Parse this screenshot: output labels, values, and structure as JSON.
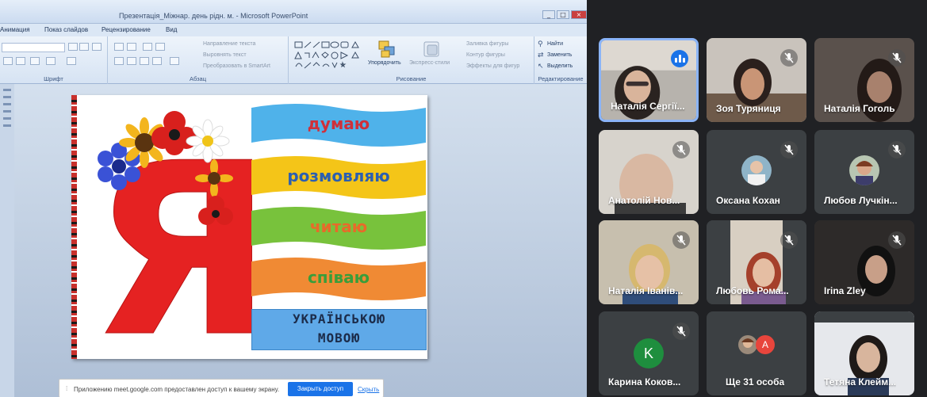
{
  "window": {
    "title": "Презентація_Міжнар. день рідн. м. - Microsoft PowerPoint",
    "controls": [
      "_",
      "□",
      "×"
    ]
  },
  "menu": {
    "items": [
      "Анимация",
      "Показ слайдов",
      "Рецензирование",
      "Вид"
    ]
  },
  "ribbon": {
    "groups": {
      "font": "Шрифт",
      "paragraph": "Абзац",
      "drawing": "Рисование",
      "editing": "Редактирование"
    },
    "paragraph_items": [
      "Направление текста",
      "Выровнять текст",
      "Преобразовать в SmartArt"
    ],
    "drawing_items": {
      "arrange": "Упорядочить",
      "quick_styles": "Экспресс-стили",
      "fill": "Заливка фигуры",
      "outline": "Контур фигуры",
      "effects": "Эффекты для фигур"
    },
    "editing_items": [
      "Найти",
      "Заменить",
      "Выделить"
    ]
  },
  "slide": {
    "big_letter": "Я",
    "words": [
      "думаю",
      "розмовляю",
      "читаю",
      "співаю"
    ],
    "word_colors": [
      "#d0303a",
      "#2c5fb0",
      "#e86a2a",
      "#3a9d3a"
    ],
    "band_colors": [
      "#4fb2ea",
      "#f4c518",
      "#78c23c",
      "#f08a34"
    ],
    "bottom_line1": "УКРАЇНСЬКОЮ",
    "bottom_line2": "МОВОЮ"
  },
  "share_bar": {
    "message": "Приложению meet.google.com предоставлен доступ к вашему экрану.",
    "stop_button": "Закрыть доступ",
    "hide_link": "Скрыть"
  },
  "participants": [
    {
      "name": "Наталія Сергії...",
      "state": "speaking"
    },
    {
      "name": "Зоя Туряниця",
      "state": "muted"
    },
    {
      "name": "Наталія Гоголь",
      "state": "muted"
    },
    {
      "name": "Анатолій Нов...",
      "state": "muted"
    },
    {
      "name": "Оксана Кохан",
      "state": "muted"
    },
    {
      "name": "Любов Лучкін...",
      "state": "muted"
    },
    {
      "name": "Наталія Іванів...",
      "state": "muted"
    },
    {
      "name": "Любовь Рома...",
      "state": "muted"
    },
    {
      "name": "Irina Zley",
      "state": "muted"
    },
    {
      "name": "Карина Коков...",
      "state": "muted",
      "initial": "K"
    },
    {
      "name": "Ще 31 особа",
      "state": "more",
      "initial": "А"
    },
    {
      "name": "Тетяна Клейм...",
      "state": "video"
    }
  ],
  "colors": {
    "meet_bg": "#202124",
    "tile_bg": "#3c4043",
    "accent": "#1a73e8",
    "active_border": "#8ab4f8",
    "avatar_k": "#1e8e3e",
    "avatar_a": "#e8453c"
  }
}
